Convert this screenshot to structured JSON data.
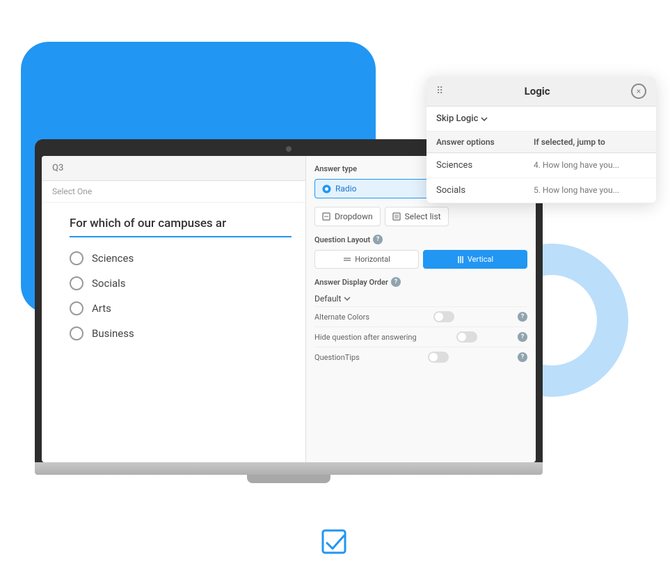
{
  "blue_bg": {},
  "circle_bg": {},
  "laptop": {
    "survey": {
      "q3_label": "Q3",
      "select_one": "Select One",
      "question": "For which of our campuses ar",
      "answers": [
        {
          "label": "Sciences"
        },
        {
          "label": "Socials"
        },
        {
          "label": "Arts"
        },
        {
          "label": "Business"
        }
      ]
    },
    "settings": {
      "answer_type_label": "Answer type",
      "radio_label": "Radio",
      "dropdown_label": "Dropdown",
      "select_list_label": "Select list",
      "question_layout_label": "Question Layout",
      "horizontal_label": "Horizontal",
      "vertical_label": "Vertical",
      "answer_display_label": "Answer Display Order",
      "default_label": "Default",
      "alternate_colors_label": "Alternate Colors",
      "hide_question_label": "Hide question after answering",
      "question_tips_label": "QuestionTips"
    }
  },
  "logic": {
    "title": "Logic",
    "close_label": "×",
    "skip_logic_label": "Skip Logic",
    "table_header_col1": "Answer options",
    "table_header_col2": "If selected, jump to",
    "rows": [
      {
        "answer": "Sciences",
        "jump": "4. How long have you..."
      },
      {
        "answer": "Socials",
        "jump": "5. How long have you..."
      }
    ]
  },
  "bottom_icon_label": "checkbox-icon"
}
